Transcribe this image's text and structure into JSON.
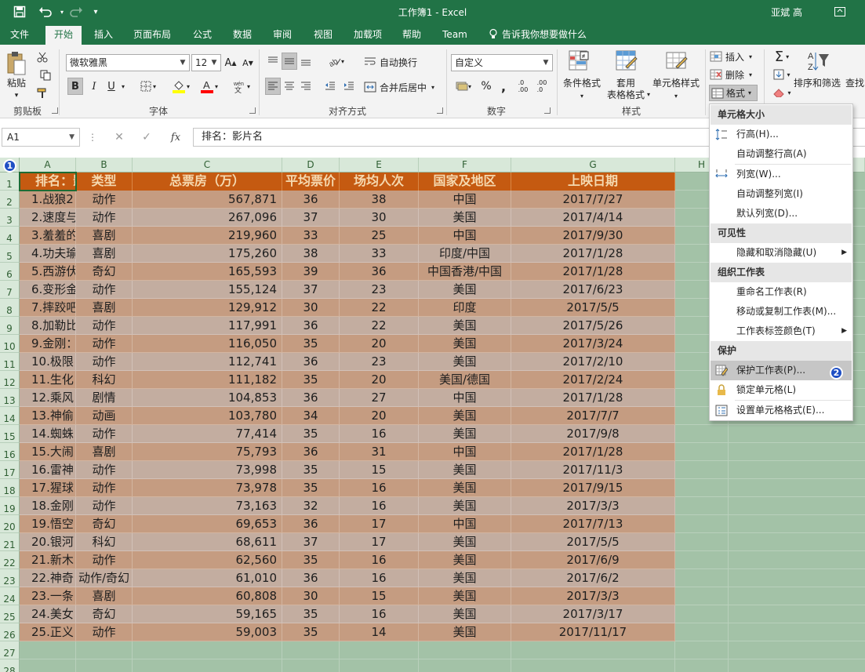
{
  "title_bar": {
    "title": "工作簿1  -  Excel",
    "user": "亚斌 高",
    "save_icon": "save-icon",
    "undo_icon": "undo-icon",
    "redo_icon": "redo-icon",
    "customize_icon": "customize-quick-access-icon",
    "color": "#217346"
  },
  "tabs": [
    "文件",
    "开始",
    "插入",
    "页面布局",
    "公式",
    "数据",
    "审阅",
    "视图",
    "加载项",
    "帮助",
    "Team"
  ],
  "active_tab": "开始",
  "tell_me": "告诉我你想要做什么",
  "ribbon": {
    "clipboard": {
      "paste": "粘贴",
      "label": "剪贴板"
    },
    "font": {
      "name": "微软雅黑",
      "size": "12",
      "bold": "B",
      "italic": "I",
      "underline": "U",
      "label": "字体",
      "font_color": "#ff0000",
      "fill_color": "#ffff00"
    },
    "alignment": {
      "wrap": "自动换行",
      "merge": "合并后居中",
      "label": "对齐方式"
    },
    "number": {
      "format": "自定义",
      "percent": "%",
      "comma": ",",
      "label": "数字"
    },
    "styles": {
      "conditional": "条件格式",
      "table_line1": "套用",
      "table_line2": "表格格式",
      "cell_styles": "单元格样式",
      "label": "样式"
    },
    "cells": {
      "insert": "插入",
      "delete": "删除",
      "format": "格式"
    },
    "editing": {
      "sort": "排序和筛选",
      "find": "查找"
    }
  },
  "formula_bar": {
    "name_box": "A1",
    "fx": "fx",
    "content": "排名：影片名"
  },
  "grid": {
    "columns": [
      "A",
      "B",
      "C",
      "D",
      "E",
      "F",
      "G",
      "H"
    ],
    "rows": [
      "1",
      "2",
      "3",
      "4",
      "5",
      "6",
      "7",
      "8",
      "9",
      "10",
      "11",
      "12",
      "13",
      "14",
      "15",
      "16",
      "17",
      "18",
      "19",
      "20",
      "21",
      "22",
      "23",
      "24",
      "25",
      "26",
      "27",
      "28"
    ],
    "headers": [
      "排名：影",
      "类型",
      "总票房（万）",
      "平均票价",
      "场均人次",
      "国家及地区",
      "上映日期"
    ],
    "records": [
      [
        "1.战狼2",
        "动作",
        "567,871",
        "36",
        "38",
        "中国",
        "2017/7/27"
      ],
      [
        "2.速度与",
        "动作",
        "267,096",
        "37",
        "30",
        "美国",
        "2017/4/14"
      ],
      [
        "3.羞羞的",
        "喜剧",
        "219,960",
        "33",
        "25",
        "中国",
        "2017/9/30"
      ],
      [
        "4.功夫瑜",
        "喜剧",
        "175,260",
        "38",
        "33",
        "印度/中国",
        "2017/1/28"
      ],
      [
        "5.西游伏",
        "奇幻",
        "165,593",
        "39",
        "36",
        "中国香港/中国",
        "2017/1/28"
      ],
      [
        "6.变形金",
        "动作",
        "155,124",
        "37",
        "23",
        "美国",
        "2017/6/23"
      ],
      [
        "7.摔跤吧",
        "喜剧",
        "129,912",
        "30",
        "22",
        "印度",
        "2017/5/5"
      ],
      [
        "8.加勒比",
        "动作",
        "117,991",
        "36",
        "22",
        "美国",
        "2017/5/26"
      ],
      [
        "9.金刚：",
        "动作",
        "116,050",
        "35",
        "20",
        "美国",
        "2017/3/24"
      ],
      [
        "10.极限",
        "动作",
        "112,741",
        "36",
        "23",
        "美国",
        "2017/2/10"
      ],
      [
        "11.生化",
        "科幻",
        "111,182",
        "35",
        "20",
        "美国/德国",
        "2017/2/24"
      ],
      [
        "12.乘风",
        "剧情",
        "104,853",
        "36",
        "27",
        "中国",
        "2017/1/28"
      ],
      [
        "13.神偷",
        "动画",
        "103,780",
        "34",
        "20",
        "美国",
        "2017/7/7"
      ],
      [
        "14.蜘蛛",
        "动作",
        "77,414",
        "35",
        "16",
        "美国",
        "2017/9/8"
      ],
      [
        "15.大闹",
        "喜剧",
        "75,793",
        "36",
        "31",
        "中国",
        "2017/1/28"
      ],
      [
        "16.雷神",
        "动作",
        "73,998",
        "35",
        "15",
        "美国",
        "2017/11/3"
      ],
      [
        "17.猩球",
        "动作",
        "73,978",
        "35",
        "16",
        "美国",
        "2017/9/15"
      ],
      [
        "18.金刚",
        "动作",
        "73,163",
        "32",
        "16",
        "美国",
        "2017/3/3"
      ],
      [
        "19.悟空",
        "奇幻",
        "69,653",
        "36",
        "17",
        "中国",
        "2017/7/13"
      ],
      [
        "20.银河",
        "科幻",
        "68,611",
        "37",
        "17",
        "美国",
        "2017/5/5"
      ],
      [
        "21.新木",
        "动作",
        "62,560",
        "35",
        "16",
        "美国",
        "2017/6/9"
      ],
      [
        "22.神奇",
        "动作/奇幻",
        "61,010",
        "36",
        "16",
        "美国",
        "2017/6/2"
      ],
      [
        "23.一条",
        "喜剧",
        "60,808",
        "30",
        "15",
        "美国",
        "2017/3/3"
      ],
      [
        "24.美女",
        "奇幻",
        "59,165",
        "35",
        "16",
        "美国",
        "2017/3/17"
      ],
      [
        "25.正义",
        "动作",
        "59,003",
        "35",
        "14",
        "美国",
        "2017/11/17"
      ]
    ],
    "header_color": "#c55a11",
    "row_color_odd": "#c59c81",
    "row_color_even": "#c3ada0"
  },
  "format_menu": {
    "sections": {
      "cell_size": "单元格大小",
      "visibility": "可见性",
      "organize": "组织工作表",
      "protection": "保护"
    },
    "items": {
      "row_height": "行高(H)...",
      "autofit_row": "自动调整行高(A)",
      "col_width": "列宽(W)...",
      "autofit_col": "自动调整列宽(I)",
      "default_width": "默认列宽(D)...",
      "hide_unhide": "隐藏和取消隐藏(U)",
      "rename": "重命名工作表(R)",
      "move_copy": "移动或复制工作表(M)...",
      "tab_color": "工作表标签颜色(T)",
      "protect_sheet": "保护工作表(P)...",
      "lock_cell": "锁定单元格(L)",
      "format_cells": "设置单元格格式(E)..."
    }
  },
  "annotations": {
    "badge1": "1",
    "badge2": "2",
    "badge_color": "#1f4fc4"
  }
}
